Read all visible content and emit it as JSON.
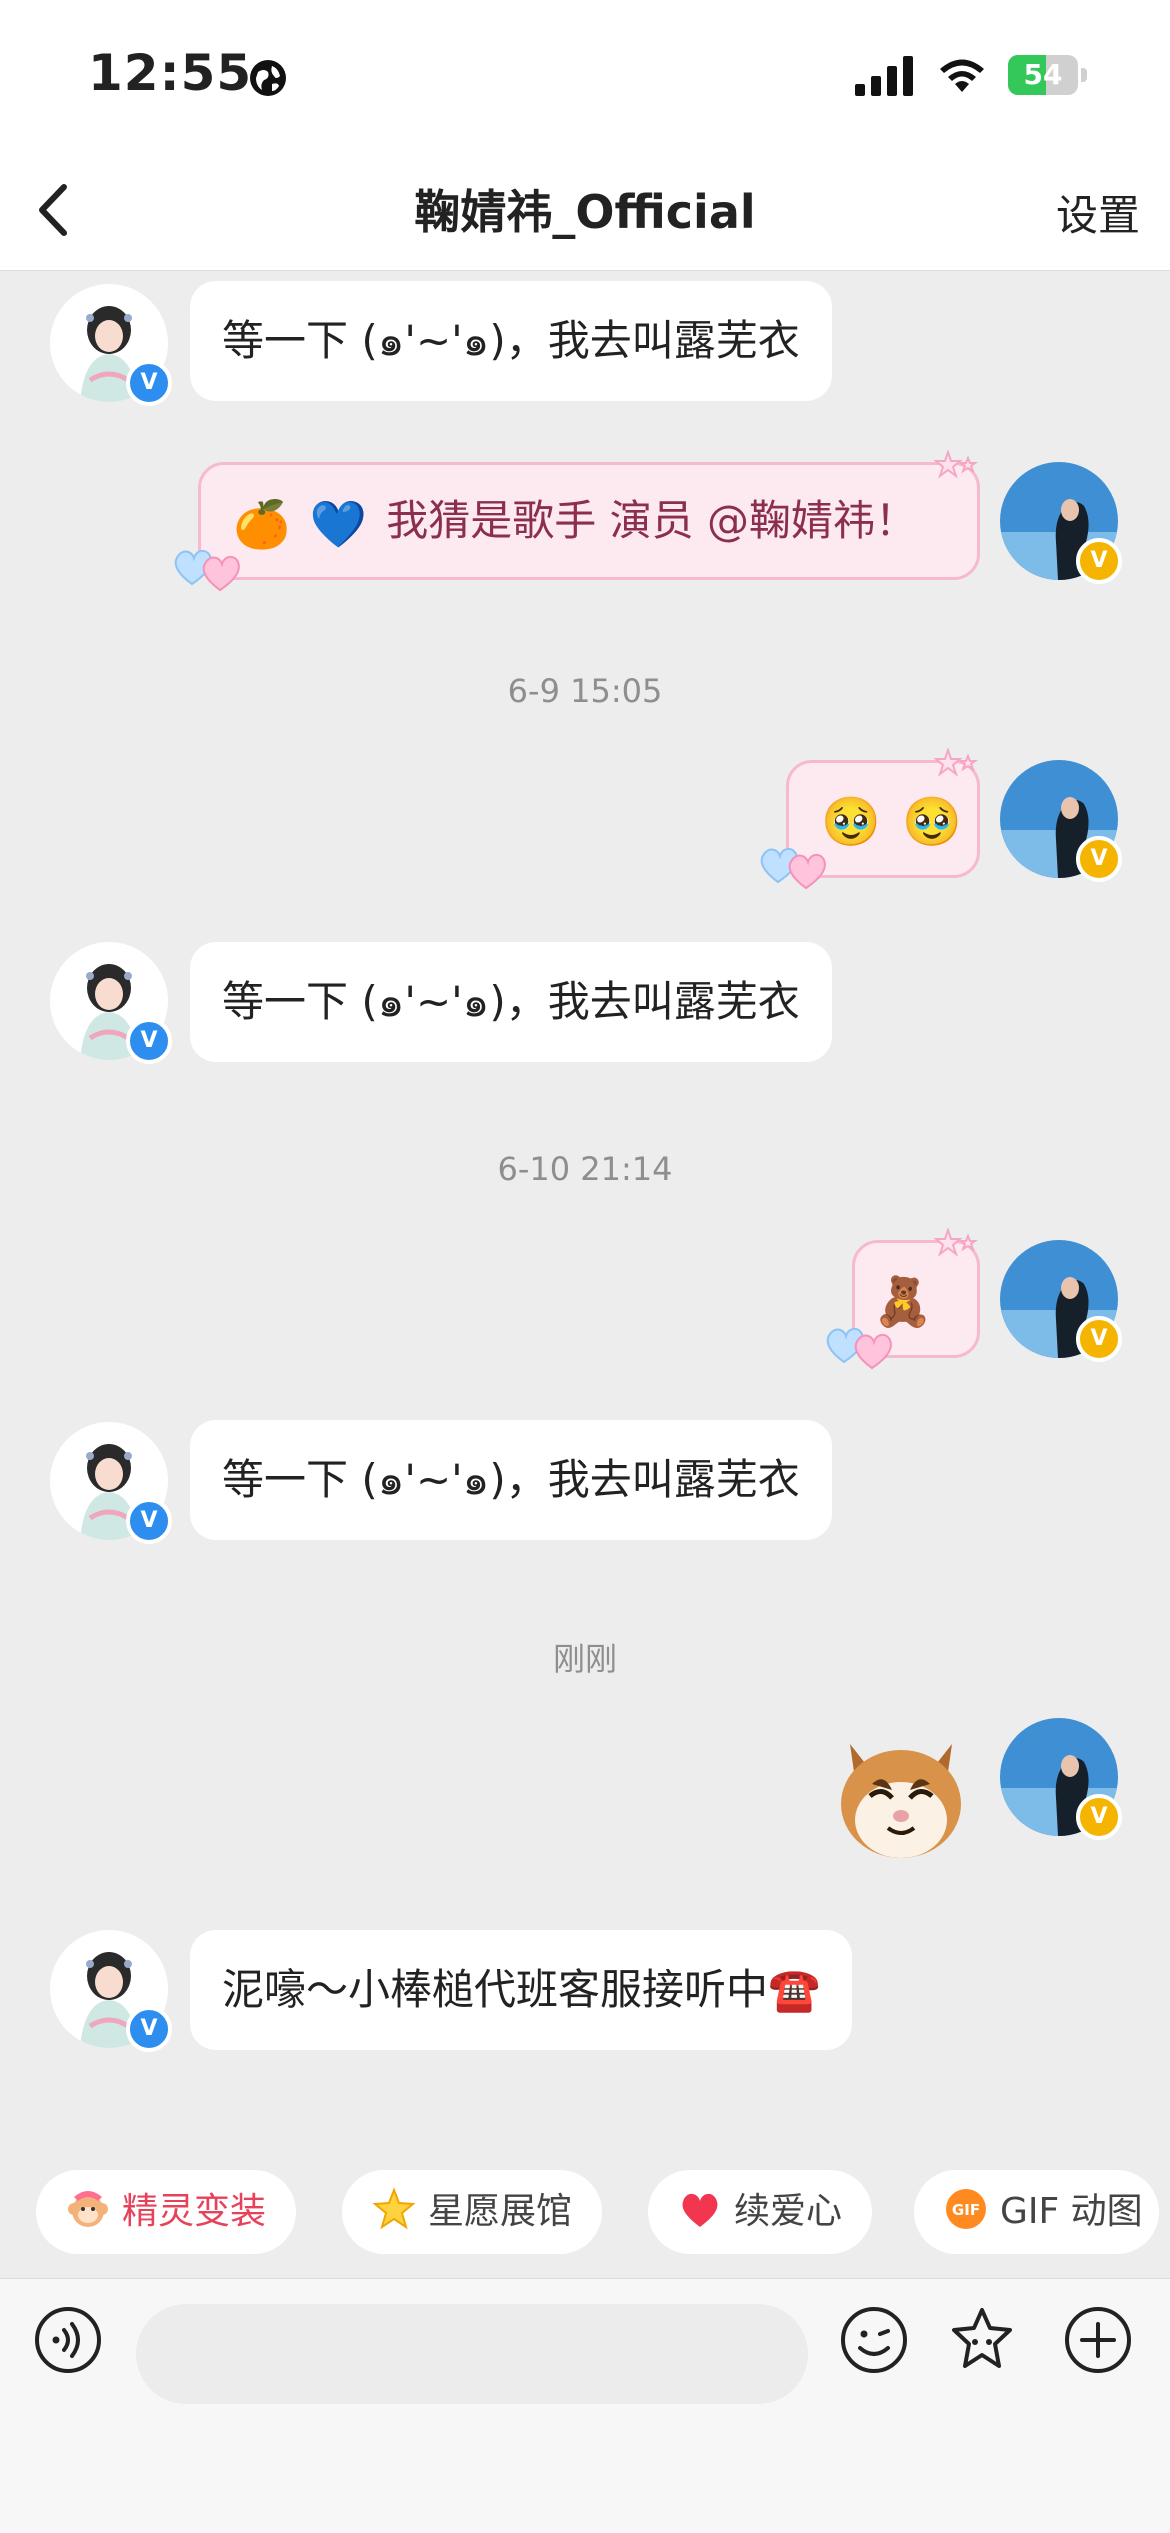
{
  "status_bar": {
    "time": "12:55",
    "battery": "54",
    "battery_level": 0.54
  },
  "nav": {
    "title": "鞠婧祎_Official",
    "settings_label": "设置"
  },
  "messages": [
    {
      "side": "in",
      "text": "等一下 (๑'~'๑)，我去叫露芜衣"
    },
    {
      "side": "out",
      "text": "我猜是歌手 演员 @鞠婧祎！",
      "emojis": [
        "🍊",
        "💙"
      ]
    },
    {
      "type": "time",
      "text": "6-9 15:05"
    },
    {
      "side": "out",
      "emojis": [
        "🥹",
        "🥹"
      ]
    },
    {
      "side": "in",
      "text": "等一下 (๑'~'๑)，我去叫露芜衣"
    },
    {
      "type": "time",
      "text": "6-10 21:14"
    },
    {
      "side": "out",
      "emojis": [
        "🧸"
      ]
    },
    {
      "side": "in",
      "text": "等一下 (๑'~'๑)，我去叫露芜衣"
    },
    {
      "type": "time",
      "text": "刚刚"
    },
    {
      "side": "out",
      "sticker": "cat-sticker"
    },
    {
      "side": "in",
      "text": "泥嚎～小棒槌代班客服接听中☎️"
    }
  ],
  "quick_actions": [
    {
      "label": "精灵变装",
      "icon": "monkey-icon"
    },
    {
      "label": "星愿展馆",
      "icon": "star-icon"
    },
    {
      "label": "续爱心",
      "icon": "heart-icon"
    },
    {
      "label": "GIF 动图",
      "icon": "gif-icon"
    }
  ],
  "input_bar": {
    "placeholder": ""
  },
  "colors": {
    "bubble_out_bg": "#fdeaf1",
    "bubble_out_border": "#f6b9cf",
    "badge_blue": "#2e8ef0",
    "badge_gold": "#f4b400",
    "accent_red": "#e8415a"
  }
}
